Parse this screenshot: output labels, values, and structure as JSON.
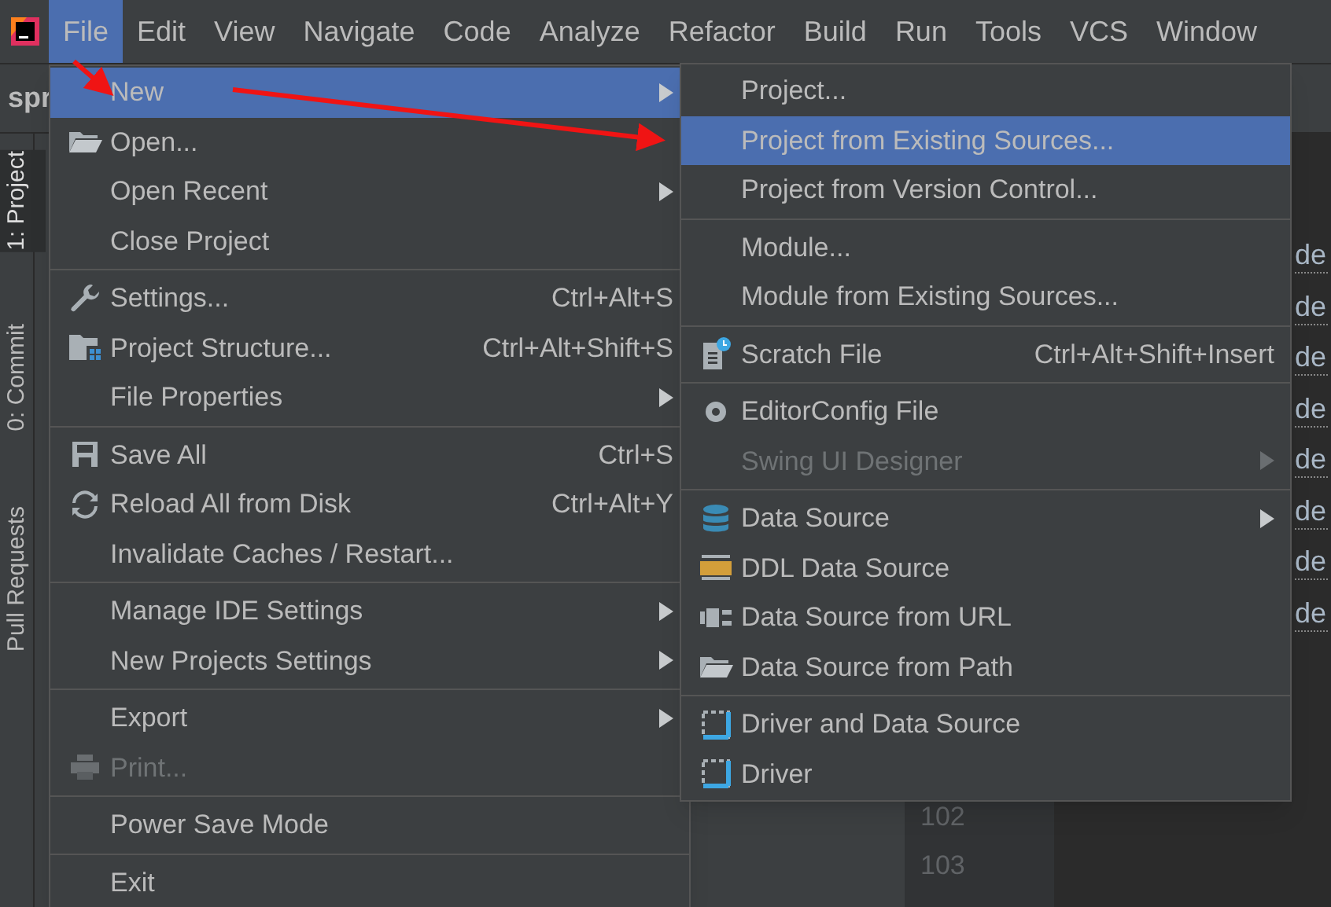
{
  "menu_bar": [
    {
      "label": "File",
      "selected": true
    },
    {
      "label": "Edit",
      "selected": false
    },
    {
      "label": "View",
      "selected": false
    },
    {
      "label": "Navigate",
      "selected": false
    },
    {
      "label": "Code",
      "selected": false
    },
    {
      "label": "Analyze",
      "selected": false
    },
    {
      "label": "Refactor",
      "selected": false
    },
    {
      "label": "Build",
      "selected": false
    },
    {
      "label": "Run",
      "selected": false
    },
    {
      "label": "Tools",
      "selected": false
    },
    {
      "label": "VCS",
      "selected": false
    },
    {
      "label": "Window",
      "selected": false
    }
  ],
  "tool_tabs": [
    {
      "label": "1: Project",
      "selected": true
    },
    {
      "label": "0: Commit",
      "selected": false
    },
    {
      "label": "Pull Requests",
      "selected": false
    }
  ],
  "project_tab": "spr",
  "editor": {
    "snippets": [
      "de",
      "de",
      "de",
      "de",
      "de",
      "de",
      "de",
      "de"
    ],
    "line_numbers": [
      "102",
      "103"
    ]
  },
  "file_menu": [
    {
      "kind": "item",
      "label": "New",
      "selected": true,
      "submenu": true,
      "disabled": false
    },
    {
      "kind": "item",
      "label": "Open...",
      "selected": false,
      "submenu": false,
      "disabled": false
    },
    {
      "kind": "item",
      "label": "Open Recent",
      "selected": false,
      "submenu": true,
      "disabled": false
    },
    {
      "kind": "item",
      "label": "Close Project",
      "selected": false,
      "submenu": false,
      "disabled": false
    },
    {
      "kind": "separator"
    },
    {
      "kind": "item",
      "label": "Settings...",
      "shortcut": "Ctrl+Alt+S",
      "selected": false,
      "submenu": false,
      "disabled": false
    },
    {
      "kind": "item",
      "label": "Project Structure...",
      "shortcut": "Ctrl+Alt+Shift+S",
      "selected": false,
      "submenu": false,
      "disabled": false
    },
    {
      "kind": "item",
      "label": "File Properties",
      "selected": false,
      "submenu": true,
      "disabled": false
    },
    {
      "kind": "separator"
    },
    {
      "kind": "item",
      "label": "Save All",
      "shortcut": "Ctrl+S",
      "selected": false,
      "submenu": false,
      "disabled": false
    },
    {
      "kind": "item",
      "label": "Reload All from Disk",
      "shortcut": "Ctrl+Alt+Y",
      "selected": false,
      "submenu": false,
      "disabled": false
    },
    {
      "kind": "item",
      "label": "Invalidate Caches / Restart...",
      "selected": false,
      "submenu": false,
      "disabled": false
    },
    {
      "kind": "separator"
    },
    {
      "kind": "item",
      "label": "Manage IDE Settings",
      "selected": false,
      "submenu": true,
      "disabled": false
    },
    {
      "kind": "item",
      "label": "New Projects Settings",
      "selected": false,
      "submenu": true,
      "disabled": false
    },
    {
      "kind": "separator"
    },
    {
      "kind": "item",
      "label": "Export",
      "selected": false,
      "submenu": true,
      "disabled": false
    },
    {
      "kind": "item",
      "label": "Print...",
      "selected": false,
      "submenu": false,
      "disabled": true
    },
    {
      "kind": "separator"
    },
    {
      "kind": "item",
      "label": "Power Save Mode",
      "selected": false,
      "submenu": false,
      "disabled": false
    },
    {
      "kind": "separator"
    },
    {
      "kind": "item",
      "label": "Exit",
      "selected": false,
      "submenu": false,
      "disabled": false
    }
  ],
  "new_submenu": [
    {
      "kind": "item",
      "label": "Project...",
      "selected": false,
      "submenu": false,
      "disabled": false
    },
    {
      "kind": "item",
      "label": "Project from Existing Sources...",
      "selected": true,
      "submenu": false,
      "disabled": false
    },
    {
      "kind": "item",
      "label": "Project from Version Control...",
      "selected": false,
      "submenu": false,
      "disabled": false
    },
    {
      "kind": "separator"
    },
    {
      "kind": "item",
      "label": "Module...",
      "selected": false,
      "submenu": false,
      "disabled": false
    },
    {
      "kind": "item",
      "label": "Module from Existing Sources...",
      "selected": false,
      "submenu": false,
      "disabled": false
    },
    {
      "kind": "separator"
    },
    {
      "kind": "item",
      "label": "Scratch File",
      "shortcut": "Ctrl+Alt+Shift+Insert",
      "selected": false,
      "submenu": false,
      "disabled": false
    },
    {
      "kind": "separator"
    },
    {
      "kind": "item",
      "label": "EditorConfig File",
      "selected": false,
      "submenu": false,
      "disabled": false
    },
    {
      "kind": "item",
      "label": "Swing UI Designer",
      "selected": false,
      "submenu": true,
      "disabled": true
    },
    {
      "kind": "separator"
    },
    {
      "kind": "item",
      "label": "Data Source",
      "selected": false,
      "submenu": true,
      "disabled": false
    },
    {
      "kind": "item",
      "label": "DDL Data Source",
      "selected": false,
      "submenu": false,
      "disabled": false
    },
    {
      "kind": "item",
      "label": "Data Source from URL",
      "selected": false,
      "submenu": false,
      "disabled": false
    },
    {
      "kind": "item",
      "label": "Data Source from Path",
      "selected": false,
      "submenu": false,
      "disabled": false
    },
    {
      "kind": "separator"
    },
    {
      "kind": "item",
      "label": "Driver and Data Source",
      "selected": false,
      "submenu": false,
      "disabled": false
    },
    {
      "kind": "item",
      "label": "Driver",
      "selected": false,
      "submenu": false,
      "disabled": false
    }
  ]
}
